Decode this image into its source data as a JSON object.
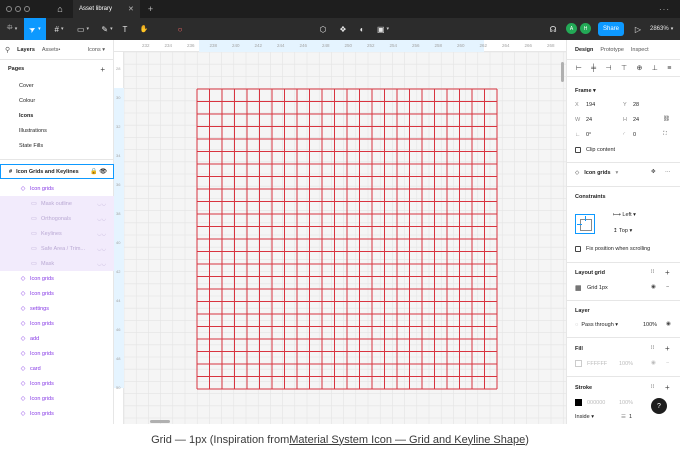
{
  "titlebar": {
    "tab_label": "Asset library",
    "tab_close": "✕",
    "new_tab": "+",
    "more": "···"
  },
  "toolbar": {
    "items": [
      {
        "name": "main-menu",
        "glyph": "⯐"
      },
      {
        "name": "move-tool",
        "glyph": "➤"
      },
      {
        "name": "frame-tool",
        "glyph": "#"
      },
      {
        "name": "shape-tool",
        "glyph": "▭"
      },
      {
        "name": "pen-tool",
        "glyph": "✎"
      },
      {
        "name": "text-tool",
        "glyph": "T"
      },
      {
        "name": "hand-tool",
        "glyph": "✋"
      },
      {
        "name": "comment-tool",
        "glyph": "💬"
      }
    ],
    "center": [
      {
        "name": "component-icon",
        "glyph": "⬡"
      },
      {
        "name": "component-set-icon",
        "glyph": "❖"
      },
      {
        "name": "contrast-icon",
        "glyph": "◐"
      },
      {
        "name": "boolean-icon",
        "glyph": "▣"
      }
    ],
    "share_label": "Share",
    "avatars": [
      "A",
      "H"
    ],
    "zoom": "2863%"
  },
  "left_panel": {
    "tabs": {
      "layers": "Layers",
      "assets": "Assets",
      "icons": "Icons"
    },
    "pages_title": "Pages",
    "pages": [
      "Cover",
      "Colour",
      "Icons",
      "Illustrations",
      "State Fills"
    ],
    "selected_page": "Icons",
    "frame_label": "Icon Grids and Keylines",
    "layers": [
      {
        "label": "Icon grids",
        "kind": "comp",
        "indent": 1
      },
      {
        "label": "Mask outline",
        "kind": "child",
        "indent": 2
      },
      {
        "label": "Orthogonals",
        "kind": "child",
        "indent": 2
      },
      {
        "label": "Keylines",
        "kind": "child",
        "indent": 2
      },
      {
        "label": "Safe Area / Trim...",
        "kind": "child",
        "indent": 2
      },
      {
        "label": "Mask",
        "kind": "child",
        "indent": 2
      },
      {
        "label": "Icon grids",
        "kind": "comp",
        "indent": 1
      },
      {
        "label": "Icon grids",
        "kind": "comp",
        "indent": 1
      },
      {
        "label": "settings",
        "kind": "comp",
        "indent": 1
      },
      {
        "label": "Icon grids",
        "kind": "comp",
        "indent": 1
      },
      {
        "label": "add",
        "kind": "comp",
        "indent": 1
      },
      {
        "label": "Icon grids",
        "kind": "comp",
        "indent": 1
      },
      {
        "label": "card",
        "kind": "comp",
        "indent": 1
      },
      {
        "label": "Icon grids",
        "kind": "comp",
        "indent": 1
      },
      {
        "label": "Icon grids",
        "kind": "comp",
        "indent": 1
      },
      {
        "label": "Icon grids",
        "kind": "comp",
        "indent": 1
      }
    ]
  },
  "canvas": {
    "ruler_top_ticks": [
      "232",
      "234",
      "236",
      "238",
      "240",
      "242",
      "244",
      "246",
      "248",
      "250",
      "252",
      "254",
      "256",
      "258",
      "260",
      "262",
      "264",
      "266",
      "268",
      "270"
    ],
    "ruler_left_ticks": [
      "28",
      "30",
      "32",
      "34",
      "36",
      "38",
      "40",
      "42",
      "44",
      "46",
      "48",
      "50"
    ],
    "grid_color": "#d8343f",
    "grid_cells": 24
  },
  "right_panel": {
    "tabs": {
      "design": "Design",
      "prototype": "Prototype",
      "inspect": "Inspect"
    },
    "frame_title": "Frame",
    "x_label": "X",
    "x_value": "194",
    "y_label": "Y",
    "y_value": "28",
    "w_label": "W",
    "w_value": "24",
    "h_label": "H",
    "h_value": "24",
    "rotation": "0°",
    "radius": "0",
    "clip_content": "Clip content",
    "component_name": "Icon grids",
    "constraints_title": "Constraints",
    "constraint_h": "Left",
    "constraint_v": "Top",
    "fix_position": "Fix position when scrolling",
    "layout_grid_title": "Layout grid",
    "grid_item": "Grid 1px",
    "layer_title": "Layer",
    "blend_mode": "Pass through",
    "layer_opacity": "100%",
    "fill_title": "Fill",
    "fill_hex": "FFFFFF",
    "fill_opacity": "100%",
    "stroke_title": "Stroke",
    "stroke_hex": "000000",
    "stroke_opacity": "100%",
    "stroke_position": "Inside",
    "stroke_weight": "1",
    "help": "?"
  },
  "caption": {
    "prefix": "Grid — 1px (Inspiration from ",
    "link": "Material System Icon — Grid and Keyline Shape",
    "suffix": ")"
  }
}
